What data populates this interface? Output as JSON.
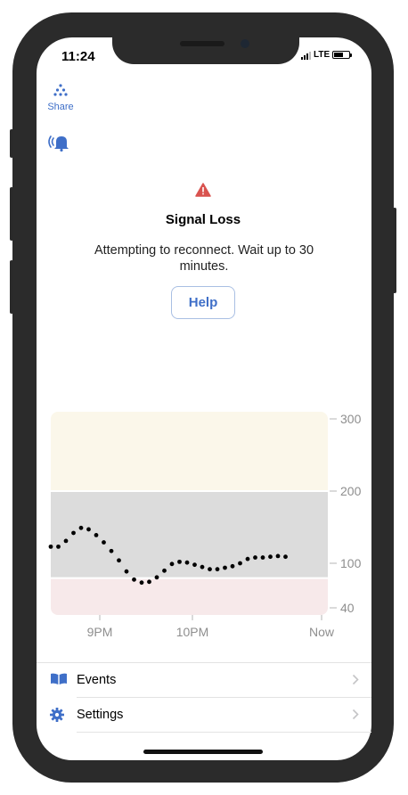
{
  "status_bar": {
    "time": "11:24",
    "network": "LTE",
    "signal_bars": 3,
    "battery_level": 0.6
  },
  "share": {
    "label": "Share",
    "icon": "share-dots-icon"
  },
  "alert_toggle": {
    "icon": "alert-sound-icon"
  },
  "alert": {
    "icon": "warning-triangle-icon",
    "title": "Signal Loss",
    "message": "Attempting to reconnect. Wait up to 30 minutes.",
    "help_label": "Help"
  },
  "colors": {
    "accent": "#3f6fc8",
    "high_zone": "#fbf7ea",
    "target_zone": "#dcdcdc",
    "low_zone": "#f7e9ea",
    "warning": "#d9534f"
  },
  "chart_data": {
    "type": "scatter",
    "y_ticks": [
      "300",
      "200",
      "100",
      "40"
    ],
    "x_ticks": [
      "9PM",
      "10PM",
      "Now"
    ],
    "zones": {
      "high_above": 200,
      "low_below": 80
    },
    "ylim": [
      40,
      300
    ],
    "points": [
      {
        "t": 0,
        "v": 123
      },
      {
        "t": 5,
        "v": 123
      },
      {
        "t": 10,
        "v": 131
      },
      {
        "t": 15,
        "v": 142
      },
      {
        "t": 20,
        "v": 149
      },
      {
        "t": 25,
        "v": 147
      },
      {
        "t": 30,
        "v": 139
      },
      {
        "t": 35,
        "v": 129
      },
      {
        "t": 40,
        "v": 117
      },
      {
        "t": 45,
        "v": 104
      },
      {
        "t": 50,
        "v": 89
      },
      {
        "t": 55,
        "v": 78
      },
      {
        "t": 60,
        "v": 74
      },
      {
        "t": 65,
        "v": 75
      },
      {
        "t": 70,
        "v": 81
      },
      {
        "t": 75,
        "v": 90
      },
      {
        "t": 80,
        "v": 99
      },
      {
        "t": 85,
        "v": 102
      },
      {
        "t": 90,
        "v": 101
      },
      {
        "t": 95,
        "v": 98
      },
      {
        "t": 100,
        "v": 95
      },
      {
        "t": 105,
        "v": 92
      },
      {
        "t": 110,
        "v": 92
      },
      {
        "t": 115,
        "v": 94
      },
      {
        "t": 120,
        "v": 96
      },
      {
        "t": 125,
        "v": 100
      },
      {
        "t": 130,
        "v": 106
      },
      {
        "t": 135,
        "v": 108
      },
      {
        "t": 140,
        "v": 108
      },
      {
        "t": 145,
        "v": 109
      },
      {
        "t": 150,
        "v": 110
      },
      {
        "t": 155,
        "v": 109
      }
    ]
  },
  "menu": [
    {
      "label": "Events",
      "icon": "book-icon"
    },
    {
      "label": "Settings",
      "icon": "gear-icon"
    }
  ]
}
